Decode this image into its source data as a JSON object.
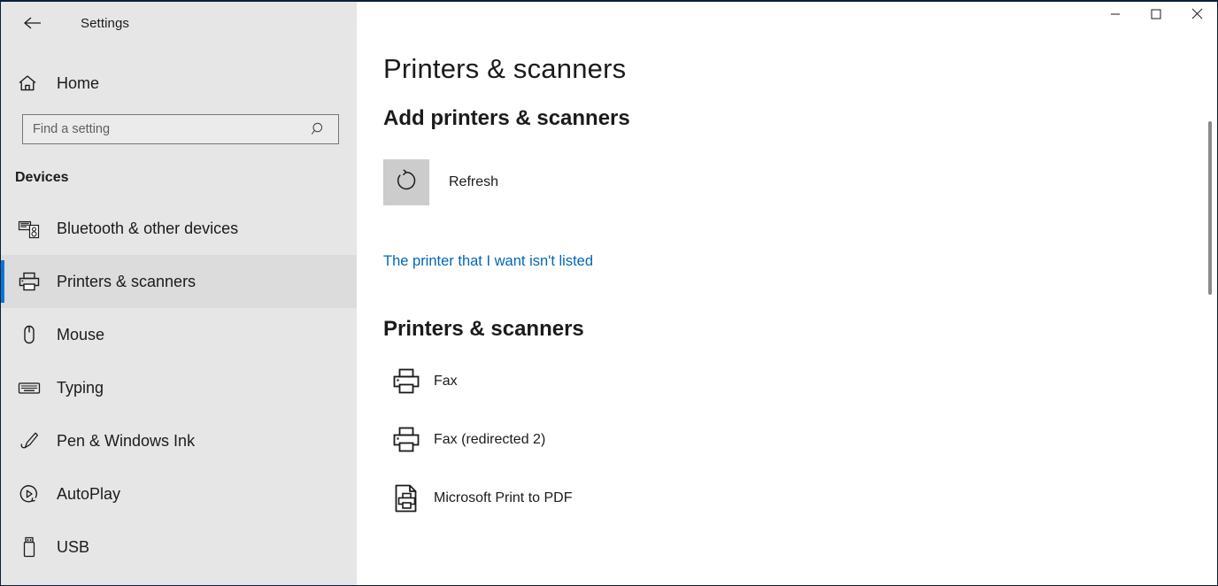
{
  "window": {
    "title": "Settings",
    "back_icon": "back-arrow-icon",
    "controls": {
      "minimize": "minimize-icon",
      "maximize": "maximize-icon",
      "close": "close-icon"
    }
  },
  "sidebar": {
    "home": {
      "label": "Home",
      "icon": "home-icon"
    },
    "search": {
      "placeholder": "Find a setting",
      "value": "",
      "icon": "search-icon"
    },
    "section_title": "Devices",
    "items": [
      {
        "label": "Bluetooth & other devices",
        "icon": "bluetooth-devices-icon",
        "selected": false
      },
      {
        "label": "Printers & scanners",
        "icon": "printer-icon",
        "selected": true
      },
      {
        "label": "Mouse",
        "icon": "mouse-icon",
        "selected": false
      },
      {
        "label": "Typing",
        "icon": "keyboard-icon",
        "selected": false
      },
      {
        "label": "Pen & Windows Ink",
        "icon": "pen-icon",
        "selected": false
      },
      {
        "label": "AutoPlay",
        "icon": "autoplay-icon",
        "selected": false
      },
      {
        "label": "USB",
        "icon": "usb-icon",
        "selected": false
      }
    ]
  },
  "main": {
    "page_title": "Printers & scanners",
    "add_section": {
      "heading": "Add printers & scanners",
      "refresh_label": "Refresh",
      "refresh_icon": "refresh-icon",
      "not_listed_link": "The printer that I want isn't listed"
    },
    "printers_section": {
      "heading": "Printers & scanners",
      "items": [
        {
          "name": "Fax",
          "icon": "printer-icon"
        },
        {
          "name": "Fax (redirected 2)",
          "icon": "printer-icon"
        },
        {
          "name": "Microsoft Print to PDF",
          "icon": "print-to-pdf-icon"
        }
      ]
    }
  },
  "colors": {
    "accent": "#0078d7",
    "link": "#0067b8",
    "sidebar_bg": "#e6e6e6",
    "selected_bg": "#dcdcdc",
    "refresh_bg": "#cccccc"
  }
}
